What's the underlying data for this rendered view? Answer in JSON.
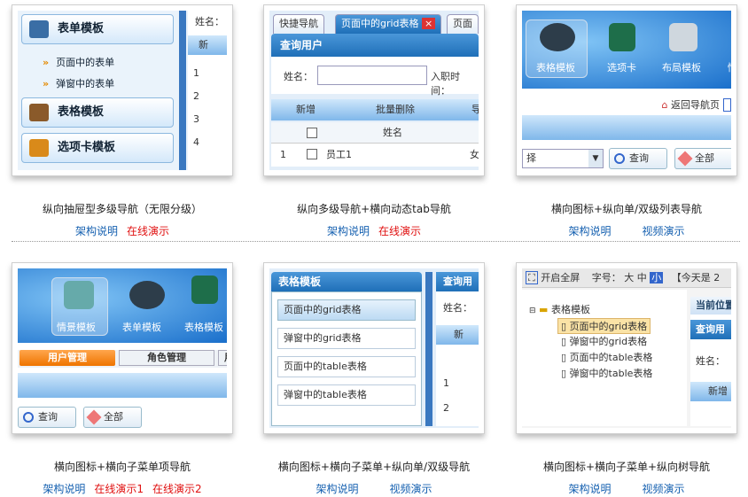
{
  "cards": [
    {
      "title": "纵向抽屉型多级导航（无限分级）",
      "links": [
        {
          "label": "架构说明",
          "color": "blue"
        },
        {
          "label": "在线演示",
          "color": "red"
        }
      ],
      "thumb": {
        "menus": [
          "表单模板",
          "表格模板",
          "选项卡模板"
        ],
        "sub_items": [
          "页面中的表单",
          "弹窗中的表单"
        ],
        "name_label": "姓名：",
        "add_label": "新",
        "rows": [
          "1",
          "2",
          "3",
          "4"
        ]
      }
    },
    {
      "title": "纵向多级导航+横向动态tab导航",
      "links": [
        {
          "label": "架构说明",
          "color": "blue"
        },
        {
          "label": "在线演示",
          "color": "red"
        }
      ],
      "thumb": {
        "tabs": [
          "快捷导航",
          "页面中的grid表格",
          "页面中"
        ],
        "panel_title": "查询用户",
        "name_label": "姓名：",
        "date_label": "入职时间：",
        "toolbar": [
          "新增",
          "批量删除",
          "导"
        ],
        "col_header": "姓名",
        "row_num": "1",
        "row_name": "员工1",
        "row_extra": "女"
      }
    },
    {
      "title": "横向图标+纵向单/双级列表导航",
      "links": [
        {
          "label": "架构说明",
          "color": "blue"
        },
        {
          "label": "视频演示",
          "color": "blue"
        }
      ],
      "thumb": {
        "icons": [
          "表格模板",
          "选项卡",
          "布局模板",
          "情"
        ],
        "back_label": "返回导航页",
        "select_value": "择",
        "query_label": "查询",
        "all_label": "全部"
      }
    },
    {
      "title": "横向图标+横向子菜单项导航",
      "links": [
        {
          "label": "架构说明",
          "color": "blue"
        },
        {
          "label": "在线演示1",
          "color": "red"
        },
        {
          "label": "在线演示2",
          "color": "red"
        }
      ],
      "thumb": {
        "icons": [
          "情景模板",
          "表单模板",
          "表格模板"
        ],
        "submenus": [
          "用户管理",
          "角色管理",
          "用"
        ],
        "query_label": "查询",
        "all_label": "全部"
      }
    },
    {
      "title": "横向图标+横向子菜单+纵向单/双级导航",
      "links": [
        {
          "label": "架构说明",
          "color": "blue"
        },
        {
          "label": "视频演示",
          "color": "blue"
        }
      ],
      "thumb": {
        "panel_title": "表格模板",
        "list": [
          "页面中的grid表格",
          "弹窗中的grid表格",
          "页面中的table表格",
          "弹窗中的table表格"
        ],
        "right_title": "查询用",
        "name_label": "姓名：",
        "add_label": "新",
        "rows": [
          "1",
          "2"
        ]
      }
    },
    {
      "title": "横向图标+横向子菜单+纵向树导航",
      "links": [
        {
          "label": "架构说明",
          "color": "blue"
        },
        {
          "label": "视频演示",
          "color": "blue"
        }
      ],
      "thumb": {
        "fullscreen": "开启全屏",
        "font_label": "字号：",
        "font_sizes": [
          "大",
          "中",
          "小"
        ],
        "today": "【今天是 2",
        "tree_root": "表格模板",
        "tree_items": [
          "页面中的grid表格",
          "弹窗中的grid表格",
          "页面中的table表格",
          "弹窗中的table表格"
        ],
        "current_pos": "当前位置",
        "query_title": "查询用",
        "name_label": "姓名：",
        "add_label": "新增"
      }
    }
  ]
}
